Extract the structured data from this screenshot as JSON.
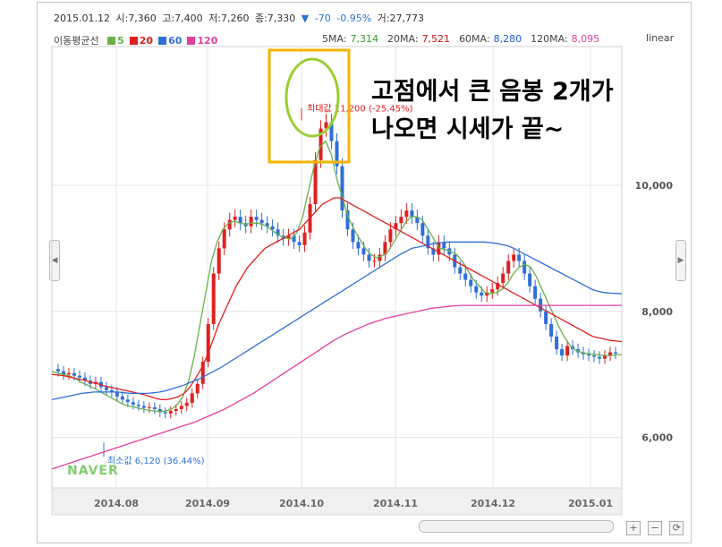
{
  "info": {
    "date": "2015.01.12",
    "open": "시:7,360",
    "high": "고:7,400",
    "low": "저:7,260",
    "close": "종:7,330",
    "change_arrow": "▼",
    "change": "-70",
    "change_pct": "-0.95%",
    "volume": "거:27,773"
  },
  "legend": {
    "title": "이동평균선",
    "items": [
      {
        "label": "5",
        "color": "#6ab04c"
      },
      {
        "label": "20",
        "color": "#e02020"
      },
      {
        "label": "60",
        "color": "#2f6fd6"
      },
      {
        "label": "120",
        "color": "#e040a0"
      }
    ]
  },
  "ma_values": [
    {
      "name": "5MA:",
      "value": "7,314",
      "color": "#2e9e2e"
    },
    {
      "name": "20MA:",
      "value": "7,521",
      "color": "#d01010"
    },
    {
      "name": "60MA:",
      "value": "8,280",
      "color": "#1a5fc8"
    },
    {
      "name": "120MA:",
      "value": "8,095",
      "color": "#e040a0"
    }
  ],
  "scale_label": "linear",
  "annotation_max": "최대값 11,200 (-25.45%)",
  "annotation_min": "최소값 6,120 (36.44%)",
  "overlay_text": [
    "고점에서 큰 음봉 2개가",
    "나오면 시세가 끝~"
  ],
  "watermark": "NAVER",
  "buttons": {
    "zoom_in": "+",
    "zoom_out": "−",
    "reset": "⟳",
    "left": "◀",
    "right": "▶"
  },
  "colors": {
    "up": "#e02020",
    "down": "#2f6fd6",
    "highlight_box": "#f5b400",
    "highlight_circle": "#9acd32"
  },
  "chart_data": {
    "type": "candlestick",
    "title": "",
    "xlabel": "",
    "ylabel": "",
    "x_ticks": [
      "2014.08",
      "2014.09",
      "2014.10",
      "2014.11",
      "2014.12",
      "2015.01"
    ],
    "y_ticks": [
      "6,000",
      "8,000",
      "10,000"
    ],
    "ylim": [
      5200,
      12200
    ],
    "close_series": [
      7050,
      7000,
      7020,
      6980,
      6950,
      6900,
      6850,
      6880,
      6800,
      6750,
      6720,
      6650,
      6600,
      6560,
      6520,
      6500,
      6470,
      6480,
      6450,
      6400,
      6380,
      6420,
      6450,
      6500,
      6550,
      6700,
      6850,
      7200,
      7800,
      8600,
      9000,
      9300,
      9450,
      9500,
      9400,
      9350,
      9500,
      9450,
      9400,
      9350,
      9300,
      9200,
      9150,
      9200,
      9100,
      9050,
      9250,
      9700,
      10400,
      10900,
      11000,
      10700,
      10300,
      9600,
      9300,
      9100,
      9000,
      8900,
      8800,
      8800,
      8900,
      9100,
      9300,
      9400,
      9500,
      9600,
      9500,
      9400,
      9200,
      9000,
      8900,
      9100,
      9000,
      8900,
      8700,
      8600,
      8500,
      8400,
      8300,
      8250,
      8300,
      8350,
      8450,
      8600,
      8800,
      8900,
      8800,
      8600,
      8400,
      8200,
      8000,
      7800,
      7600,
      7400,
      7300,
      7450,
      7400,
      7350,
      7320,
      7300,
      7280,
      7250,
      7300,
      7350,
      7330
    ],
    "series": [
      {
        "name": "5",
        "values": [
          7050,
          7020,
          7000,
          6980,
          6940,
          6880,
          6840,
          6800,
          6750,
          6700,
          6650,
          6600,
          6550,
          6510,
          6490,
          6470,
          6450,
          6430,
          6420,
          6410,
          6420,
          6450,
          6520,
          6650,
          6900,
          7300,
          7800,
          8300,
          8800,
          9100,
          9300,
          9400,
          9430,
          9400,
          9380,
          9400,
          9400,
          9380,
          9330,
          9260,
          9200,
          9160,
          9150,
          9250,
          9500,
          9900,
          10300,
          10600,
          10700,
          10500,
          10100,
          9800,
          9500,
          9300,
          9150,
          9000,
          8900,
          8850,
          8880,
          8950,
          9100,
          9250,
          9400,
          9500,
          9500,
          9450,
          9300,
          9150,
          9000,
          8980,
          8950,
          8900,
          8800,
          8650,
          8500,
          8400,
          8300,
          8280,
          8300,
          8350,
          8450,
          8600,
          8700,
          8750,
          8700,
          8550,
          8350,
          8150,
          7950,
          7750,
          7580,
          7450,
          7380,
          7350,
          7330,
          7320,
          7310,
          7300,
          7300,
          7310,
          7314
        ]
      },
      {
        "name": "20",
        "values": [
          7000,
          6990,
          6980,
          6960,
          6940,
          6920,
          6900,
          6870,
          6850,
          6820,
          6800,
          6780,
          6760,
          6740,
          6720,
          6700,
          6680,
          6650,
          6620,
          6600,
          6600,
          6620,
          6650,
          6700,
          6800,
          6950,
          7100,
          7300,
          7550,
          7800,
          8000,
          8200,
          8400,
          8550,
          8700,
          8800,
          8900,
          9000,
          9050,
          9100,
          9150,
          9200,
          9250,
          9300,
          9400,
          9500,
          9600,
          9700,
          9750,
          9800,
          9800,
          9750,
          9700,
          9650,
          9600,
          9550,
          9500,
          9450,
          9400,
          9350,
          9300,
          9250,
          9200,
          9150,
          9100,
          9050,
          9000,
          8950,
          8900,
          8850,
          8800,
          8750,
          8700,
          8650,
          8600,
          8550,
          8500,
          8450,
          8400,
          8350,
          8300,
          8250,
          8200,
          8150,
          8100,
          8050,
          8000,
          7950,
          7900,
          7850,
          7800,
          7750,
          7700,
          7650,
          7600,
          7580,
          7560,
          7540,
          7530,
          7521
        ]
      },
      {
        "name": "60",
        "values": [
          6600,
          6620,
          6640,
          6660,
          6680,
          6700,
          6710,
          6720,
          6720,
          6720,
          6720,
          6720,
          6710,
          6700,
          6700,
          6700,
          6700,
          6710,
          6720,
          6740,
          6770,
          6800,
          6830,
          6870,
          6910,
          6950,
          7000,
          7050,
          7100,
          7160,
          7220,
          7280,
          7340,
          7400,
          7460,
          7520,
          7580,
          7640,
          7700,
          7760,
          7820,
          7880,
          7940,
          8000,
          8060,
          8120,
          8180,
          8240,
          8300,
          8360,
          8420,
          8480,
          8540,
          8600,
          8660,
          8720,
          8780,
          8840,
          8900,
          8950,
          9000,
          9020,
          9040,
          9060,
          9080,
          9090,
          9100,
          9100,
          9100,
          9100,
          9100,
          9100,
          9100,
          9090,
          9080,
          9060,
          9040,
          9000,
          8950,
          8900,
          8850,
          8800,
          8750,
          8700,
          8650,
          8600,
          8550,
          8500,
          8450,
          8400,
          8350,
          8320,
          8300,
          8290,
          8285,
          8280
        ]
      },
      {
        "name": "120",
        "values": [
          5500,
          5530,
          5560,
          5590,
          5620,
          5650,
          5680,
          5710,
          5740,
          5770,
          5800,
          5830,
          5860,
          5890,
          5920,
          5950,
          5980,
          6010,
          6040,
          6070,
          6100,
          6130,
          6160,
          6190,
          6220,
          6250,
          6290,
          6330,
          6370,
          6410,
          6450,
          6500,
          6550,
          6600,
          6650,
          6700,
          6760,
          6820,
          6880,
          6940,
          7000,
          7060,
          7120,
          7180,
          7240,
          7300,
          7360,
          7420,
          7480,
          7540,
          7590,
          7640,
          7680,
          7720,
          7760,
          7800,
          7830,
          7860,
          7890,
          7910,
          7930,
          7950,
          7970,
          7990,
          8010,
          8030,
          8050,
          8060,
          8070,
          8080,
          8090,
          8095,
          8095,
          8095,
          8095,
          8095,
          8095,
          8095,
          8095,
          8095,
          8095,
          8095,
          8095,
          8095,
          8095,
          8095,
          8095,
          8095,
          8095,
          8095,
          8095,
          8095,
          8095,
          8095,
          8095,
          8095,
          8095,
          8095,
          8095,
          8095
        ]
      }
    ],
    "max_point": {
      "value": 11200,
      "label": "최대값 11,200 (-25.45%)"
    },
    "min_point": {
      "value": 6120,
      "label": "최소값 6,120 (36.44%)"
    },
    "grid": true
  }
}
